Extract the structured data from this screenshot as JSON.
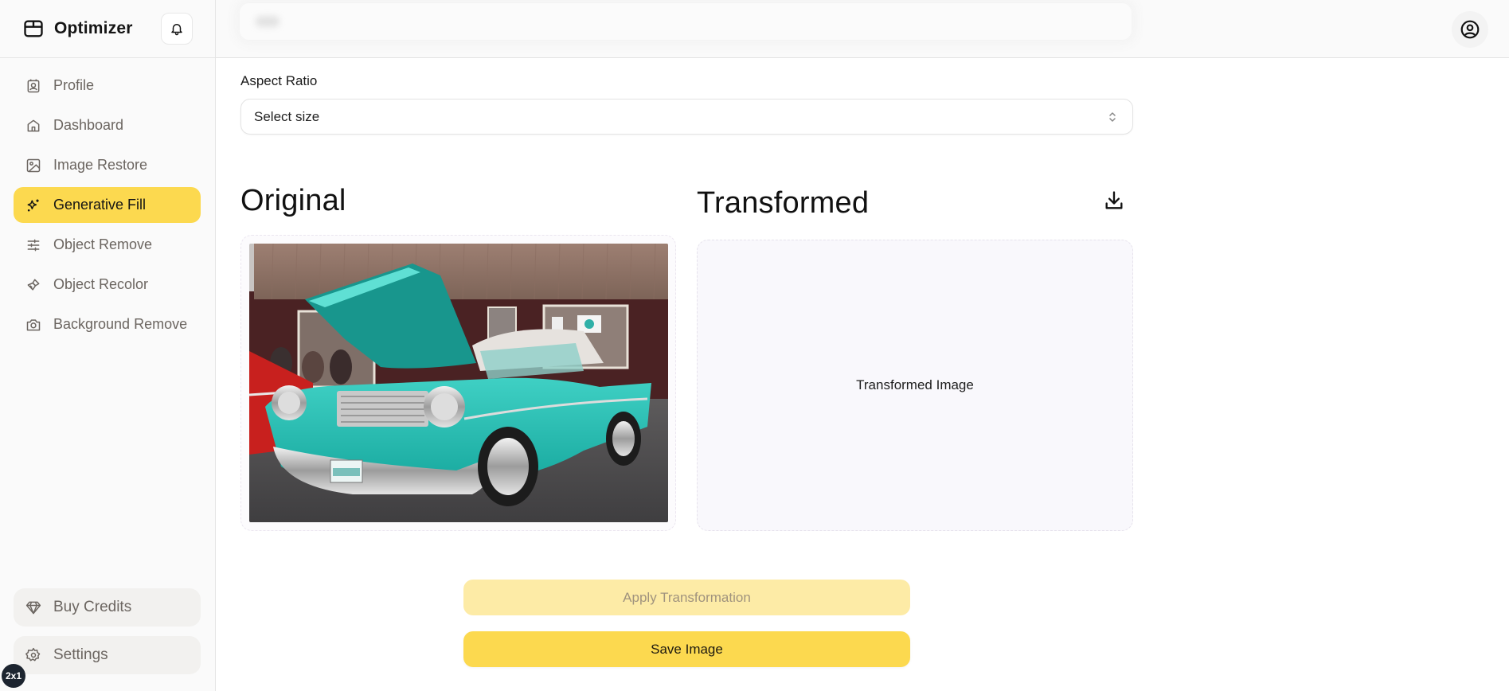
{
  "app": {
    "name": "Optimizer",
    "badge": "2x1"
  },
  "sidebar": {
    "items": [
      {
        "label": "Profile",
        "icon": "profile-card-icon",
        "active": false
      },
      {
        "label": "Dashboard",
        "icon": "home-icon",
        "active": false
      },
      {
        "label": "Image Restore",
        "icon": "image-icon",
        "active": false
      },
      {
        "label": "Generative Fill",
        "icon": "sparkles-icon",
        "active": true
      },
      {
        "label": "Object Remove",
        "icon": "sliders-icon",
        "active": false
      },
      {
        "label": "Object Recolor",
        "icon": "paintbrush-icon",
        "active": false
      },
      {
        "label": "Background Remove",
        "icon": "camera-icon",
        "active": false
      }
    ],
    "bottom": [
      {
        "label": "Buy Credits",
        "icon": "gem-icon"
      },
      {
        "label": "Settings",
        "icon": "gear-icon"
      }
    ]
  },
  "topbar": {
    "search_blurred": true,
    "bell_icon": "bell-icon",
    "user_icon": "user-circle-icon"
  },
  "form": {
    "aspect_label": "Aspect Ratio",
    "select_value": "Select size"
  },
  "panels": {
    "original_title": "Original",
    "transformed_title": "Transformed",
    "transformed_placeholder": "Transformed Image",
    "original_image_alt": "Turquoise classic car with hood open in front of a shop"
  },
  "actions": {
    "apply_label": "Apply Transformation",
    "apply_disabled": true,
    "save_label": "Save Image"
  },
  "colors": {
    "accent": "#fcd94f",
    "accent_disabled": "#fdeba6",
    "sidebar_text": "#6b6560"
  }
}
